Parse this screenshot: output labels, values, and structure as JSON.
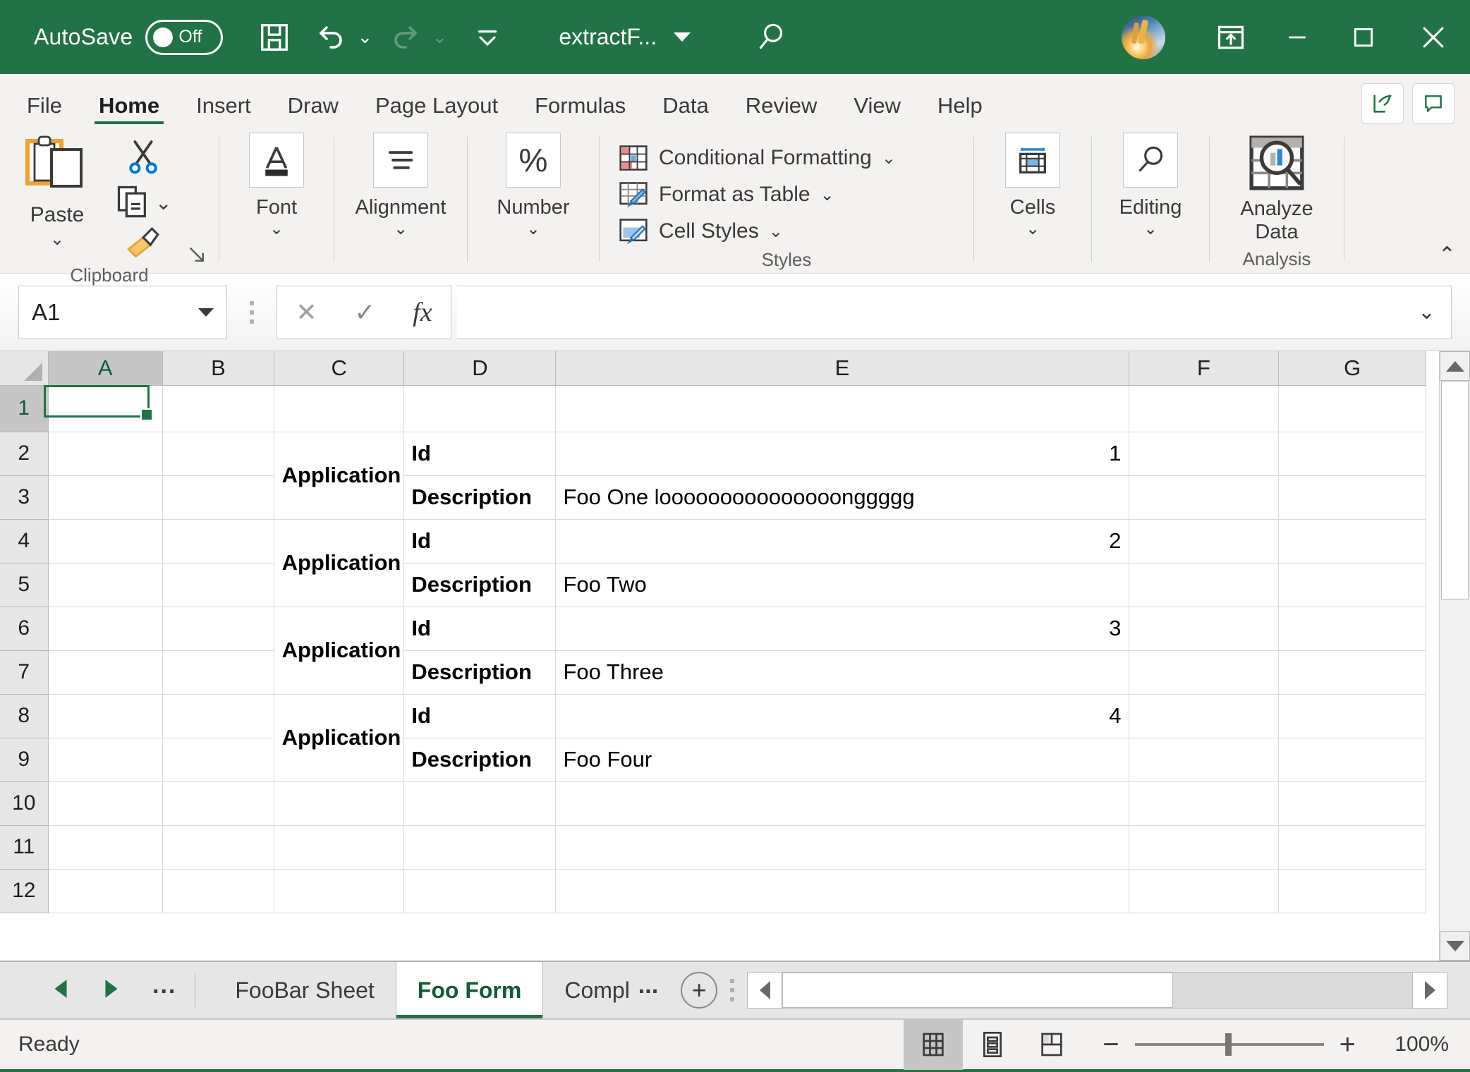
{
  "titlebar": {
    "autosave_label": "AutoSave",
    "autosave_state": "Off",
    "save_icon": "save-icon",
    "undo_icon": "undo-icon",
    "redo_icon": "redo-icon",
    "customize_qat_icon": "customize-quick-access-toolbar-icon",
    "document_title": "extractF...",
    "search_icon": "search-icon",
    "avatar_name": "user-avatar",
    "ribbon_display_icon": "ribbon-display-options-icon",
    "minimize_label": "—",
    "maximize_label": "□",
    "close_label": "✕"
  },
  "ribbon": {
    "tabs": [
      {
        "label": "File",
        "active": false
      },
      {
        "label": "Home",
        "active": true
      },
      {
        "label": "Insert",
        "active": false
      },
      {
        "label": "Draw",
        "active": false
      },
      {
        "label": "Page Layout",
        "active": false
      },
      {
        "label": "Formulas",
        "active": false
      },
      {
        "label": "Data",
        "active": false
      },
      {
        "label": "Review",
        "active": false
      },
      {
        "label": "View",
        "active": false
      },
      {
        "label": "Help",
        "active": false
      }
    ],
    "share_icon": "share-icon",
    "comments_icon": "comments-icon",
    "collapse_label": "⌃",
    "groups": {
      "clipboard": {
        "name": "Clipboard",
        "paste_label": "Paste",
        "paste_caret": "⌄",
        "cut_icon": "scissors-icon",
        "copy_icon": "copy-icon",
        "copy_caret": "⌄",
        "format_painter_icon": "format-painter-icon",
        "dialog_launcher_icon": "dialog-launcher-icon"
      },
      "font": {
        "name": "Font",
        "label": "Font",
        "caret": "⌄",
        "icon": "font-color-icon"
      },
      "alignment": {
        "name": "Alignment",
        "label": "Alignment",
        "caret": "⌄",
        "icon": "align-icon"
      },
      "number": {
        "name": "Number",
        "label": "Number",
        "caret": "⌄",
        "icon": "percent-icon"
      },
      "styles": {
        "name": "Styles",
        "items": [
          {
            "label": "Conditional Formatting",
            "caret": "⌄",
            "icon": "conditional-formatting-icon"
          },
          {
            "label": "Format as Table",
            "caret": "⌄",
            "icon": "format-as-table-icon"
          },
          {
            "label": "Cell Styles",
            "caret": "⌄",
            "icon": "cell-styles-icon"
          }
        ]
      },
      "cells": {
        "name": "Cells",
        "label": "Cells",
        "caret": "⌄",
        "icon": "cells-icon"
      },
      "editing": {
        "name": "Editing",
        "label": "Editing",
        "caret": "⌄",
        "icon": "find-icon"
      },
      "analysis": {
        "name": "Analysis",
        "button_line1": "Analyze",
        "button_line2": "Data",
        "icon": "analyze-data-icon"
      }
    }
  },
  "formula_bar": {
    "name_box_value": "A1",
    "cancel_icon": "cancel-icon",
    "enter_icon": "enter-icon",
    "function_icon": "insert-function-icon",
    "formula_value": "",
    "formula_placeholder": "",
    "expand_caret": "⌄"
  },
  "grid": {
    "column_headers": [
      "A",
      "B",
      "C",
      "D",
      "E",
      "F",
      "G"
    ],
    "selected_column": "A",
    "selected_cell": "A1",
    "row_headers": [
      "1",
      "2",
      "3",
      "4",
      "5",
      "6",
      "7",
      "8",
      "9",
      "10",
      "11",
      "12"
    ],
    "selected_row": "1",
    "rows": [
      {
        "num": "1",
        "A": "",
        "B": "",
        "C": "",
        "D": "",
        "E": "",
        "F": "",
        "G": ""
      },
      {
        "num": "2",
        "A": "",
        "B": "",
        "C": "Application",
        "D": "Id",
        "E": "1",
        "F": "",
        "G": ""
      },
      {
        "num": "3",
        "A": "",
        "B": "",
        "C": "",
        "D": "Description",
        "E": "Foo One looooooooooooooonggggg",
        "F": "",
        "G": ""
      },
      {
        "num": "4",
        "A": "",
        "B": "",
        "C": "Application",
        "D": "Id",
        "E": "2",
        "F": "",
        "G": ""
      },
      {
        "num": "5",
        "A": "",
        "B": "",
        "C": "",
        "D": "Description",
        "E": "Foo Two",
        "F": "",
        "G": ""
      },
      {
        "num": "6",
        "A": "",
        "B": "",
        "C": "Application",
        "D": "Id",
        "E": "3",
        "F": "",
        "G": ""
      },
      {
        "num": "7",
        "A": "",
        "B": "",
        "C": "",
        "D": "Description",
        "E": "Foo Three",
        "F": "",
        "G": ""
      },
      {
        "num": "8",
        "A": "",
        "B": "",
        "C": "Application",
        "D": "Id",
        "E": "4",
        "F": "",
        "G": ""
      },
      {
        "num": "9",
        "A": "",
        "B": "",
        "C": "",
        "D": "Description",
        "E": "Foo Four",
        "F": "",
        "G": ""
      },
      {
        "num": "10",
        "A": "",
        "B": "",
        "C": "",
        "D": "",
        "E": "",
        "F": "",
        "G": ""
      },
      {
        "num": "11",
        "A": "",
        "B": "",
        "C": "",
        "D": "",
        "E": "",
        "F": "",
        "G": ""
      },
      {
        "num": "12",
        "A": "",
        "B": "",
        "C": "",
        "D": "",
        "E": "",
        "F": "",
        "G": ""
      }
    ],
    "merged_labels": {
      "app1": "Application",
      "app2": "Application",
      "app3": "Application",
      "app4": "Application",
      "id_label": "Id",
      "desc_label": "Description"
    },
    "values": {
      "id1": "1",
      "id2": "2",
      "id3": "3",
      "id4": "4",
      "desc1": "Foo One looooooooooooooonggggg",
      "desc2": "Foo Two",
      "desc3": "Foo Three",
      "desc4": "Foo Four"
    }
  },
  "sheet_tabs": {
    "prev_icon": "previous-sheet-icon",
    "next_icon": "next-sheet-icon",
    "more_sheets_label": "...",
    "tabs": [
      {
        "label": "FooBar Sheet",
        "active": false
      },
      {
        "label": "Foo Form",
        "active": true
      },
      {
        "label": "Compl",
        "active": false
      }
    ],
    "overflow_label": "...",
    "add_sheet_label": "+"
  },
  "status_bar": {
    "status_text": "Ready",
    "view_normal_icon": "normal-view-icon",
    "view_pagelayout_icon": "page-layout-view-icon",
    "view_pagebreak_icon": "page-break-preview-icon",
    "zoom_out_label": "−",
    "zoom_in_label": "+",
    "zoom_level": "100%"
  },
  "colors": {
    "brand_green": "#217346",
    "ribbon_bg": "#f3f2f1",
    "header_gray": "#e6e6e6",
    "selection_green": "#217346"
  }
}
